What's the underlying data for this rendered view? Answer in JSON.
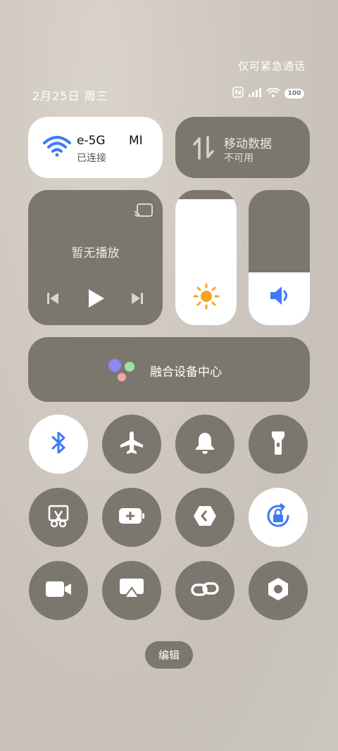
{
  "status": {
    "emergency_text": "仅可紧急通话",
    "date": "2月25日 周三",
    "battery": "100"
  },
  "wifi": {
    "ssid": "e-5G",
    "ssid_suffix": "MI",
    "status": "已连接",
    "accent": "#3e7bf2"
  },
  "mobile_data": {
    "title": "移动数据",
    "status": "不可用"
  },
  "media": {
    "status": "暂无播放"
  },
  "brightness": {
    "level": 0.93
  },
  "volume": {
    "level": 0.39
  },
  "fusion": {
    "label": "融合设备中心"
  },
  "edit": {
    "label": "编辑"
  },
  "toggles": [
    {
      "icon": "bluetooth-icon",
      "on": true
    },
    {
      "icon": "airplane-icon",
      "on": false
    },
    {
      "icon": "bell-icon",
      "on": false
    },
    {
      "icon": "flashlight-icon",
      "on": false
    },
    {
      "icon": "screenshot-icon",
      "on": false
    },
    {
      "icon": "battery-saver-icon",
      "on": false
    },
    {
      "icon": "developer-icon",
      "on": false
    },
    {
      "icon": "rotation-lock-icon",
      "on": true
    },
    {
      "icon": "video-icon",
      "on": false
    },
    {
      "icon": "screen-mirror-icon",
      "on": false
    },
    {
      "icon": "link-icon",
      "on": false
    },
    {
      "icon": "settings-hex-icon",
      "on": false
    }
  ]
}
